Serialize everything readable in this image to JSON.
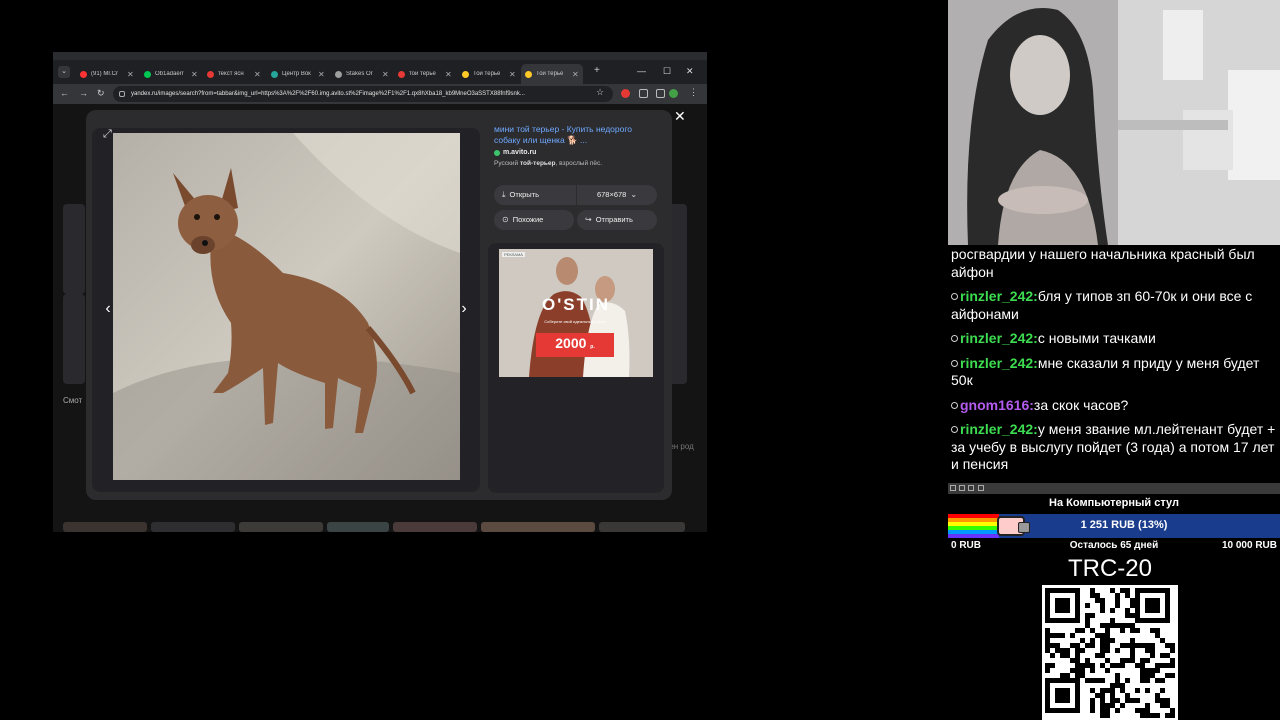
{
  "browser": {
    "tabs": [
      {
        "title": "(91) Mr.Cr",
        "color": "#ff3333"
      },
      {
        "title": "Ob1adaerr",
        "color": "#00c853"
      },
      {
        "title": "текст ясн",
        "color": "#e53935"
      },
      {
        "title": "Центр Вок",
        "color": "#26a69a"
      },
      {
        "title": "Stakes Or",
        "color": "#9e9e9e"
      },
      {
        "title": "той терье",
        "color": "#e53935"
      },
      {
        "title": "Той терье",
        "color": "#ffca28"
      },
      {
        "title": "Той терье",
        "color": "#ffca28"
      }
    ],
    "url": "yandex.ru/images/search?from=tabbar&img_url=https%3A%2F%2F60.img.avito.st%2Fimage%2F1%2F1.qx8hXba18_kb9MneO3aSSTX88fnf9snk..."
  },
  "modal": {
    "result_title": "мини той терьер - Купить недорого собаку или щенка 🐕 ...",
    "source": "m.avito.ru",
    "desc_prefix": "Русский ",
    "desc_bold": "той-терьер",
    "desc_suffix": ", взрослый пёс.",
    "open_label": "Открыть",
    "size_label": "678×678",
    "similar_label": "Похожие",
    "share_label": "Отправить",
    "ad": {
      "tag": "РЕКЛАМА",
      "brand": "O'STIN",
      "subtitle": "Соберите свой идеальный образ",
      "price": "2000",
      "price_unit": "р."
    }
  },
  "page_side_text": {
    "left_label": "Смот",
    "right_label": "пен род"
  },
  "chat": {
    "messages": [
      {
        "user": "",
        "color": "#ffffff",
        "text": "росгвардии у нашего начальника красный был айфон"
      },
      {
        "user": "rinzler_242:",
        "color": "#3ddc50",
        "text": "бля у типов зп 60-70к и они все с айфонами"
      },
      {
        "user": "rinzler_242:",
        "color": "#3ddc50",
        "text": "с новыми тачками"
      },
      {
        "user": "rinzler_242:",
        "color": "#3ddc50",
        "text": "мне сказали я приду у меня будет 50к"
      },
      {
        "user": "gnom1616:",
        "color": "#b45cf0",
        "text": "за скок часов?"
      },
      {
        "user": "rinzler_242:",
        "color": "#3ddc50",
        "text": "у меня звание мл.лейтенант будет + за учебу в выслугу пойдет (3 года) а потом 17 лет и пенсия"
      }
    ]
  },
  "goal": {
    "title": "На Компьютерный стул",
    "amount": "1 251 RUB (13%)",
    "progress": 0.13,
    "min": "0 RUB",
    "remaining": "Осталось 65 дней",
    "max": "10 000 RUB"
  },
  "trc_label": "TRC-20"
}
